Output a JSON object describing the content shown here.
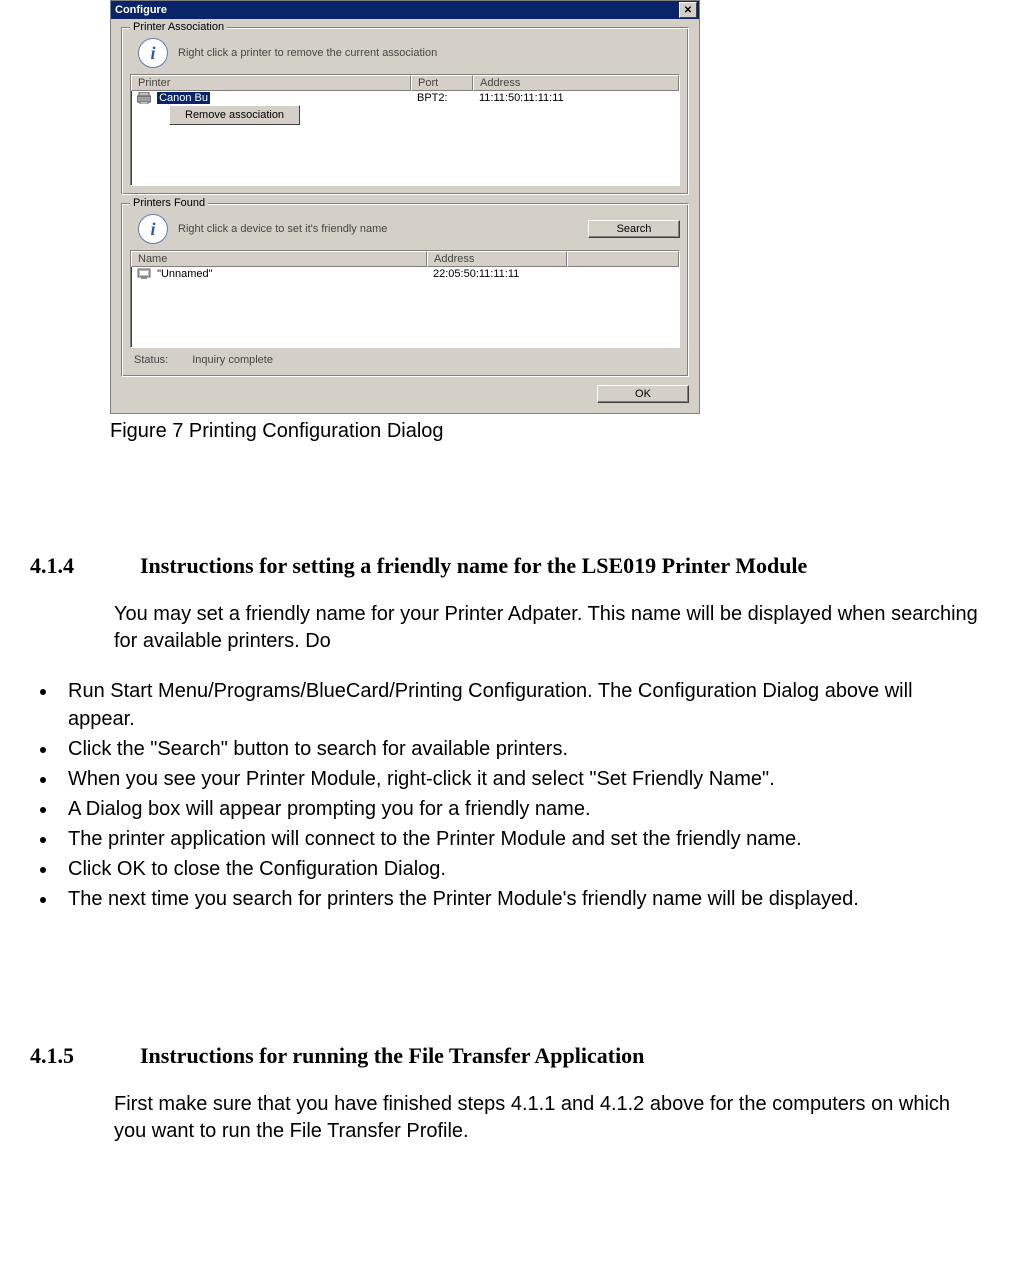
{
  "dialog": {
    "title": "Configure",
    "close_glyph": "✕",
    "group_assoc": {
      "legend": "Printer Association",
      "info_text": "Right click a printer to remove the current association",
      "headers": {
        "printer": "Printer",
        "port": "Port",
        "address": "Address"
      },
      "row": {
        "printer": "Canon Bu",
        "port": "BPT2:",
        "address": "11:11:50:11:11:11"
      },
      "context_item": "Remove association"
    },
    "group_found": {
      "legend": "Printers Found",
      "info_text": "Right click a device to set it's friendly name",
      "search_label": "Search",
      "headers": {
        "name": "Name",
        "address": "Address"
      },
      "row": {
        "name": "\"Unnamed\"",
        "address": "22:05:50:11:11:11"
      },
      "status_label": "Status:",
      "status_value": "Inquiry complete"
    },
    "ok_label": "OK",
    "info_glyph": "i"
  },
  "caption": "Figure 7 Printing Configuration Dialog",
  "section_414": {
    "number": "4.1.4",
    "title": "Instructions for setting a friendly name for the LSE019 Printer Module",
    "para": "You may set a friendly name for your Printer Adpater. This name will be displayed when searching for available printers. Do",
    "bullets": [
      "Run Start Menu/Programs/BlueCard/Printing Configuration. The Configuration Dialog above will appear.",
      "Click the \"Search\" button to search for available printers.",
      "When you see your Printer Module, right-click it and select \"Set Friendly Name\".",
      "A Dialog box will appear prompting you for a friendly name.",
      "The printer application will connect to the Printer Module and set the friendly name.",
      "Click OK to close the Configuration Dialog.",
      "The next time you search for printers the Printer Module's friendly name will be displayed."
    ]
  },
  "section_415": {
    "number": "4.1.5",
    "title": "Instructions for running the File Transfer Application",
    "para": "First make sure that you have finished steps 4.1.1 and 4.1.2 above for the computers on which you want to run the File Transfer Profile."
  }
}
